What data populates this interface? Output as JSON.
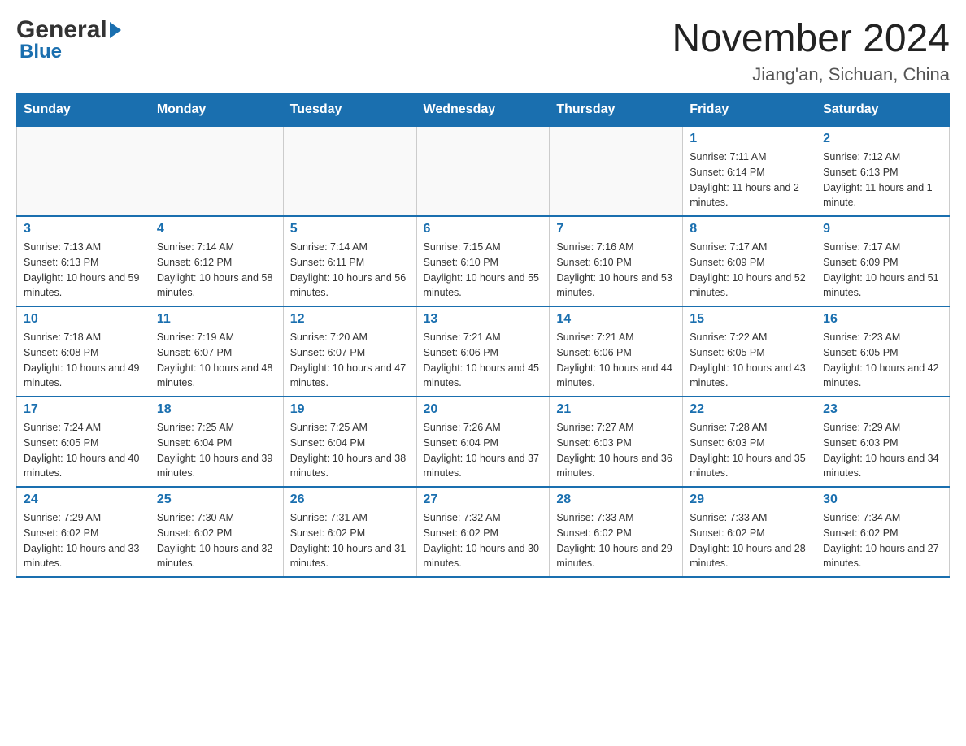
{
  "header": {
    "logo_general": "General",
    "logo_blue": "Blue",
    "month_title": "November 2024",
    "location": "Jiang'an, Sichuan, China"
  },
  "weekdays": [
    "Sunday",
    "Monday",
    "Tuesday",
    "Wednesday",
    "Thursday",
    "Friday",
    "Saturday"
  ],
  "weeks": [
    {
      "days": [
        {
          "num": "",
          "info": ""
        },
        {
          "num": "",
          "info": ""
        },
        {
          "num": "",
          "info": ""
        },
        {
          "num": "",
          "info": ""
        },
        {
          "num": "",
          "info": ""
        },
        {
          "num": "1",
          "info": "Sunrise: 7:11 AM\nSunset: 6:14 PM\nDaylight: 11 hours and 2 minutes."
        },
        {
          "num": "2",
          "info": "Sunrise: 7:12 AM\nSunset: 6:13 PM\nDaylight: 11 hours and 1 minute."
        }
      ]
    },
    {
      "days": [
        {
          "num": "3",
          "info": "Sunrise: 7:13 AM\nSunset: 6:13 PM\nDaylight: 10 hours and 59 minutes."
        },
        {
          "num": "4",
          "info": "Sunrise: 7:14 AM\nSunset: 6:12 PM\nDaylight: 10 hours and 58 minutes."
        },
        {
          "num": "5",
          "info": "Sunrise: 7:14 AM\nSunset: 6:11 PM\nDaylight: 10 hours and 56 minutes."
        },
        {
          "num": "6",
          "info": "Sunrise: 7:15 AM\nSunset: 6:10 PM\nDaylight: 10 hours and 55 minutes."
        },
        {
          "num": "7",
          "info": "Sunrise: 7:16 AM\nSunset: 6:10 PM\nDaylight: 10 hours and 53 minutes."
        },
        {
          "num": "8",
          "info": "Sunrise: 7:17 AM\nSunset: 6:09 PM\nDaylight: 10 hours and 52 minutes."
        },
        {
          "num": "9",
          "info": "Sunrise: 7:17 AM\nSunset: 6:09 PM\nDaylight: 10 hours and 51 minutes."
        }
      ]
    },
    {
      "days": [
        {
          "num": "10",
          "info": "Sunrise: 7:18 AM\nSunset: 6:08 PM\nDaylight: 10 hours and 49 minutes."
        },
        {
          "num": "11",
          "info": "Sunrise: 7:19 AM\nSunset: 6:07 PM\nDaylight: 10 hours and 48 minutes."
        },
        {
          "num": "12",
          "info": "Sunrise: 7:20 AM\nSunset: 6:07 PM\nDaylight: 10 hours and 47 minutes."
        },
        {
          "num": "13",
          "info": "Sunrise: 7:21 AM\nSunset: 6:06 PM\nDaylight: 10 hours and 45 minutes."
        },
        {
          "num": "14",
          "info": "Sunrise: 7:21 AM\nSunset: 6:06 PM\nDaylight: 10 hours and 44 minutes."
        },
        {
          "num": "15",
          "info": "Sunrise: 7:22 AM\nSunset: 6:05 PM\nDaylight: 10 hours and 43 minutes."
        },
        {
          "num": "16",
          "info": "Sunrise: 7:23 AM\nSunset: 6:05 PM\nDaylight: 10 hours and 42 minutes."
        }
      ]
    },
    {
      "days": [
        {
          "num": "17",
          "info": "Sunrise: 7:24 AM\nSunset: 6:05 PM\nDaylight: 10 hours and 40 minutes."
        },
        {
          "num": "18",
          "info": "Sunrise: 7:25 AM\nSunset: 6:04 PM\nDaylight: 10 hours and 39 minutes."
        },
        {
          "num": "19",
          "info": "Sunrise: 7:25 AM\nSunset: 6:04 PM\nDaylight: 10 hours and 38 minutes."
        },
        {
          "num": "20",
          "info": "Sunrise: 7:26 AM\nSunset: 6:04 PM\nDaylight: 10 hours and 37 minutes."
        },
        {
          "num": "21",
          "info": "Sunrise: 7:27 AM\nSunset: 6:03 PM\nDaylight: 10 hours and 36 minutes."
        },
        {
          "num": "22",
          "info": "Sunrise: 7:28 AM\nSunset: 6:03 PM\nDaylight: 10 hours and 35 minutes."
        },
        {
          "num": "23",
          "info": "Sunrise: 7:29 AM\nSunset: 6:03 PM\nDaylight: 10 hours and 34 minutes."
        }
      ]
    },
    {
      "days": [
        {
          "num": "24",
          "info": "Sunrise: 7:29 AM\nSunset: 6:02 PM\nDaylight: 10 hours and 33 minutes."
        },
        {
          "num": "25",
          "info": "Sunrise: 7:30 AM\nSunset: 6:02 PM\nDaylight: 10 hours and 32 minutes."
        },
        {
          "num": "26",
          "info": "Sunrise: 7:31 AM\nSunset: 6:02 PM\nDaylight: 10 hours and 31 minutes."
        },
        {
          "num": "27",
          "info": "Sunrise: 7:32 AM\nSunset: 6:02 PM\nDaylight: 10 hours and 30 minutes."
        },
        {
          "num": "28",
          "info": "Sunrise: 7:33 AM\nSunset: 6:02 PM\nDaylight: 10 hours and 29 minutes."
        },
        {
          "num": "29",
          "info": "Sunrise: 7:33 AM\nSunset: 6:02 PM\nDaylight: 10 hours and 28 minutes."
        },
        {
          "num": "30",
          "info": "Sunrise: 7:34 AM\nSunset: 6:02 PM\nDaylight: 10 hours and 27 minutes."
        }
      ]
    }
  ]
}
